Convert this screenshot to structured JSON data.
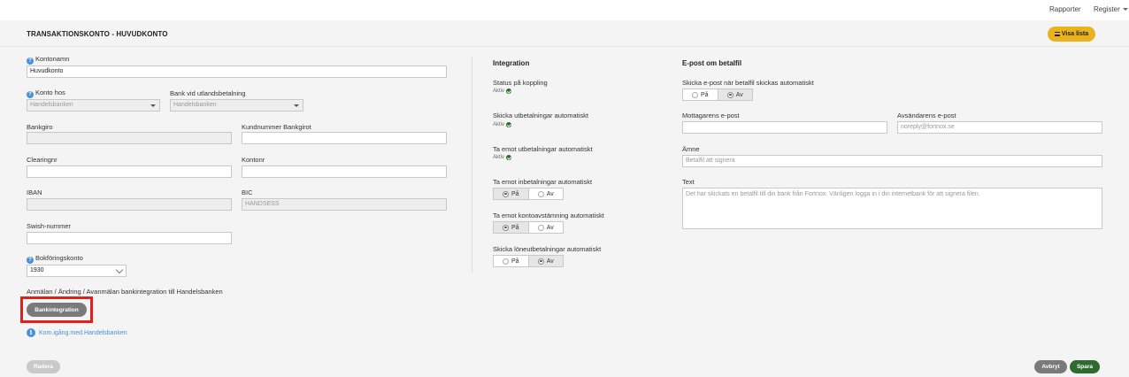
{
  "topnav": {
    "reports": "Rapporter",
    "register": "Register"
  },
  "header": {
    "title": "TRANSAKTIONSKONTO - HUVUDKONTO",
    "show_list": "Visa lista"
  },
  "form": {
    "account_name_label": "Kontonamn",
    "account_name_value": "Huvudkonto",
    "account_at_label": "Konto hos",
    "account_at_value": "Handelsbanken",
    "foreign_bank_label": "Bank vid utlandsbetalning",
    "foreign_bank_value": "Handelsbanken",
    "bankgiro_label": "Bankgiro",
    "bankgiro_value": "",
    "customer_number_label": "Kundnummer Bankgirot",
    "customer_number_value": "",
    "clearing_label": "Clearingnr",
    "clearing_value": "",
    "account_number_label": "Kontonr",
    "account_number_value": "",
    "iban_label": "IBAN",
    "iban_value": "",
    "bic_label": "BIC",
    "bic_value": "HANDSESS",
    "swish_label": "Swish-nummer",
    "swish_value": "",
    "ledger_account_label": "Bokföringskonto",
    "ledger_account_value": "1930",
    "bank_integration_text": "Anmälan / Ändring / Avanmälan bankintegration till Handelsbanken",
    "bank_integration_button": "Bankintegration",
    "get_started_link": "Kom.igång.med.Handelsbanken"
  },
  "integration": {
    "title": "Integration",
    "status_label": "Status på koppling",
    "status_value": "Aktiv",
    "send_payments_label": "Skicka utbetalningar automatiskt",
    "send_payments_value": "Aktiv",
    "receive_payments_label": "Ta emot utbetalningar automatiskt",
    "receive_payments_value": "Aktiv",
    "receive_incoming_label": "Ta emot inbetalningar automatiskt",
    "receive_reconciliation_label": "Ta emot kontoavstämning automatiskt",
    "send_salary_label": "Skicka löneutbetalningar automatiskt",
    "on": "På",
    "off": "Av"
  },
  "email": {
    "title": "E-post om betalfil",
    "auto_send_label": "Skicka e-post när betalfil skickas automatiskt",
    "recipient_label": "Mottagarens e-post",
    "recipient_value": "",
    "sender_label": "Avsändarens e-post",
    "sender_placeholder": "noreply@fortnox.se",
    "subject_label": "Ämne",
    "subject_placeholder": "Betalfil att signera",
    "text_label": "Text",
    "text_placeholder": "Det har skickats en betalfil till din bank från Fortnox. Vänligen logga in i din internetbank för att signera filen."
  },
  "footer": {
    "delete": "Radera",
    "cancel": "Avbryt",
    "save": "Spara"
  },
  "colors": {
    "accent_yellow": "#eab21b",
    "save_green": "#2f6b2f",
    "highlight_red": "#e0201b",
    "link_blue": "#4a90d9"
  }
}
